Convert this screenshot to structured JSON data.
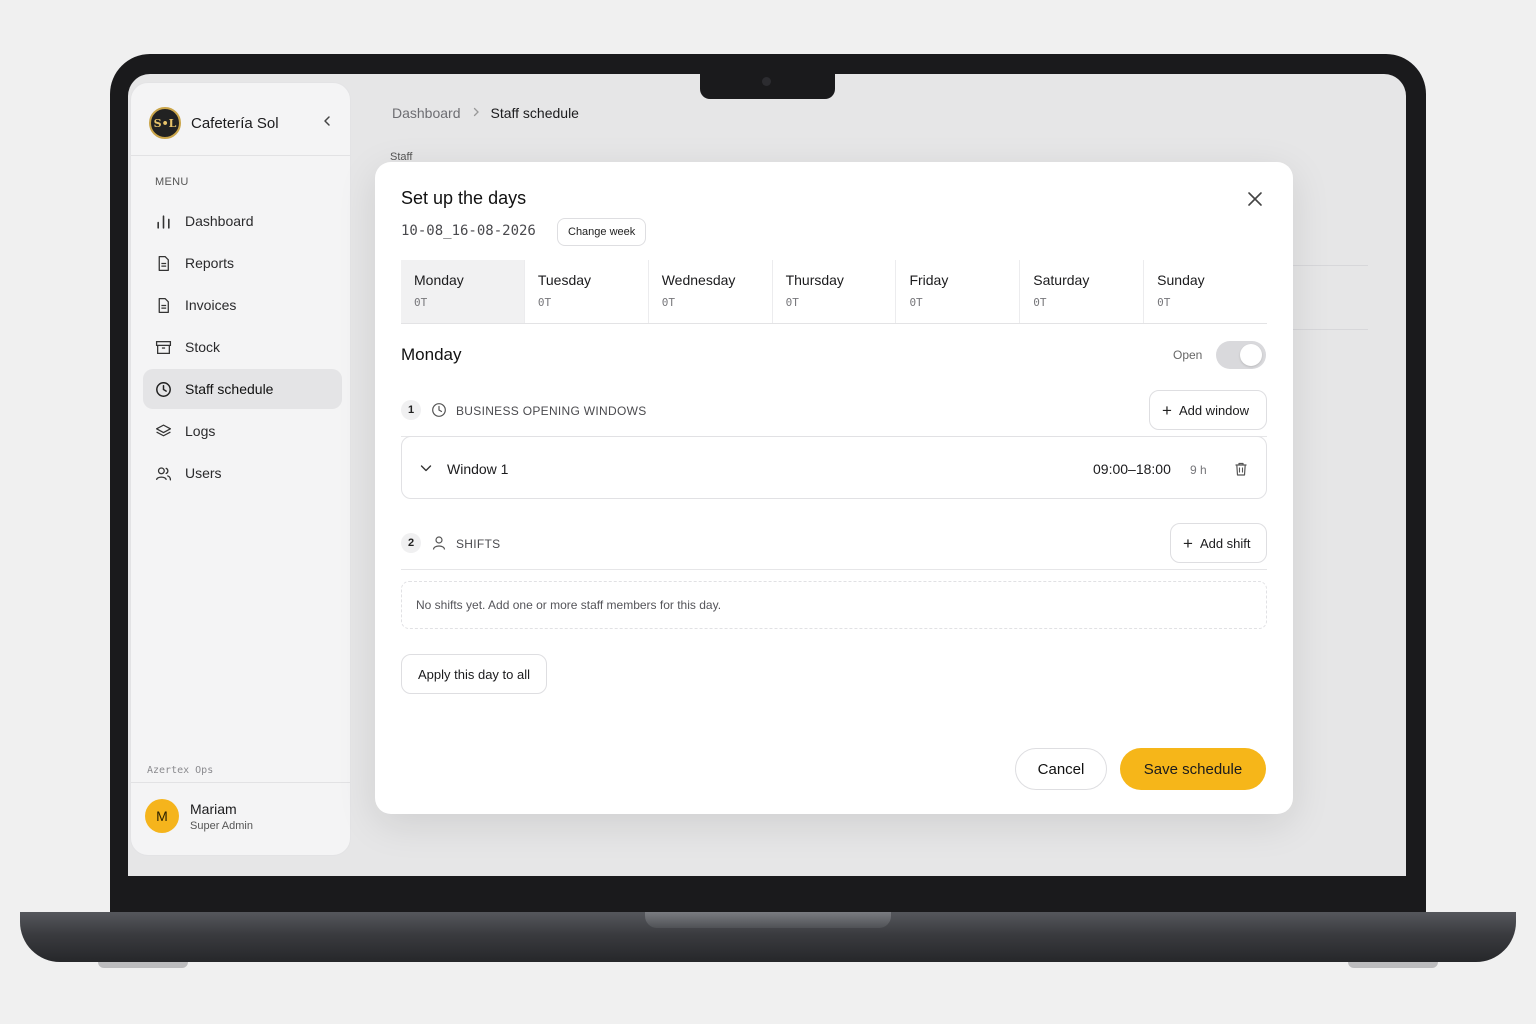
{
  "app": {
    "brand_name": "Cafetería Sol",
    "brand_logo_text": "S•L",
    "menu_label": "MENU",
    "workspace_label": "Azertex Ops"
  },
  "sidebar": {
    "items": [
      {
        "label": "Dashboard",
        "icon": "bar-chart-icon"
      },
      {
        "label": "Reports",
        "icon": "document-icon"
      },
      {
        "label": "Invoices",
        "icon": "document-icon"
      },
      {
        "label": "Stock",
        "icon": "archive-box-icon"
      },
      {
        "label": "Staff schedule",
        "icon": "clock-icon",
        "active": true
      },
      {
        "label": "Logs",
        "icon": "layers-icon"
      },
      {
        "label": "Users",
        "icon": "users-icon"
      }
    ]
  },
  "user": {
    "initial": "M",
    "name": "Mariam",
    "role": "Super Admin",
    "avatar_color": "#f5b41c"
  },
  "breadcrumb": {
    "parent": "Dashboard",
    "current": "Staff schedule"
  },
  "page": {
    "section_label": "Staff"
  },
  "modal": {
    "title": "Set up the days",
    "week_range": "10-08_16-08-2026",
    "change_week_label": "Change week",
    "days": [
      {
        "name": "Monday",
        "count": "0T",
        "active": true
      },
      {
        "name": "Tuesday",
        "count": "0T"
      },
      {
        "name": "Wednesday",
        "count": "0T"
      },
      {
        "name": "Thursday",
        "count": "0T"
      },
      {
        "name": "Friday",
        "count": "0T"
      },
      {
        "name": "Saturday",
        "count": "0T"
      },
      {
        "name": "Sunday",
        "count": "0T"
      }
    ],
    "selected_day": "Monday",
    "open_label": "Open",
    "open_toggle_on": true,
    "opening_windows": {
      "step": "1",
      "title": "BUSINESS OPENING WINDOWS",
      "add_label": "Add window",
      "windows": [
        {
          "name": "Window 1",
          "time": "09:00–18:00",
          "duration": "9 h"
        }
      ]
    },
    "shifts": {
      "step": "2",
      "title": "SHIFTS",
      "add_label": "Add shift",
      "empty_text": "No shifts yet. Add one or more staff members for this day."
    },
    "apply_label": "Apply this day to all",
    "cancel_label": "Cancel",
    "save_label": "Save schedule"
  },
  "colors": {
    "accent": "#f6b619",
    "toggle_track": "#d9d9dc"
  }
}
